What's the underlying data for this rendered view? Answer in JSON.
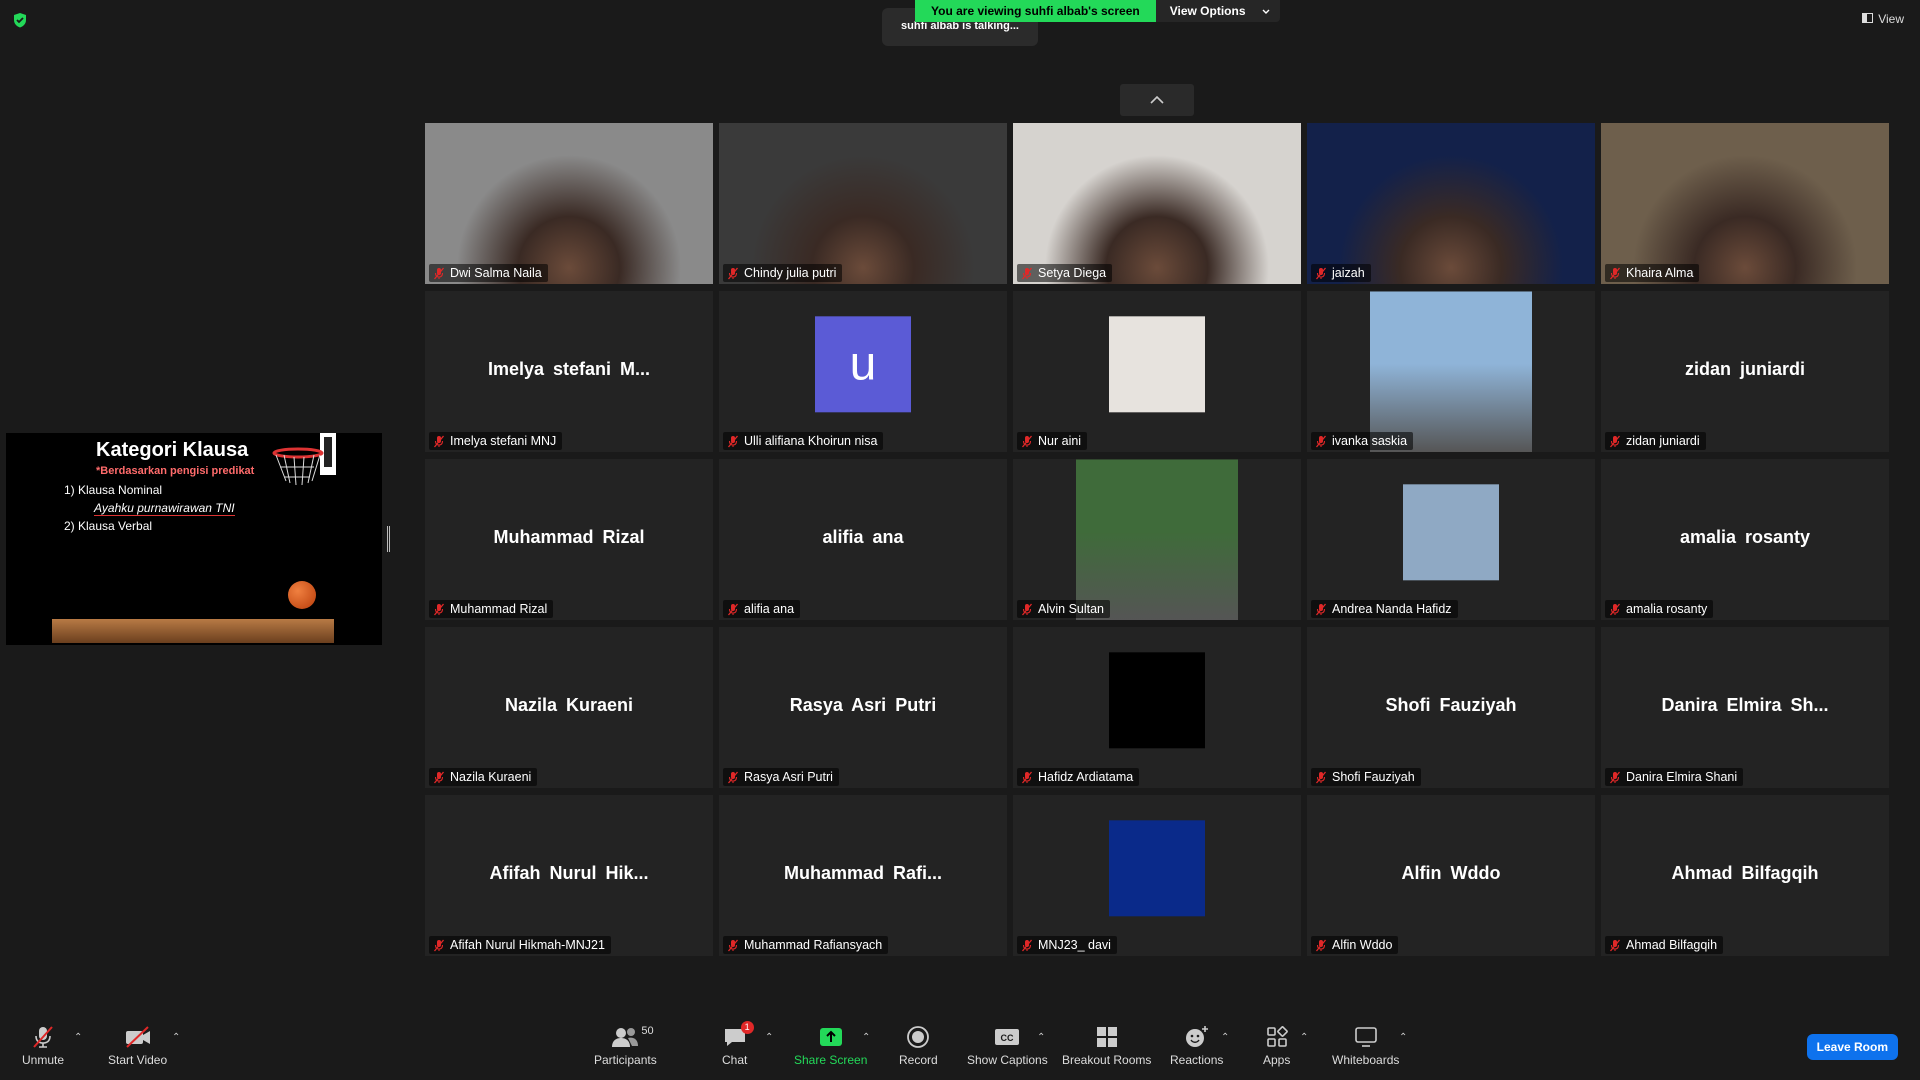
{
  "banner": {
    "viewing_text": "You are viewing suhfi albab's screen",
    "view_options": "View Options",
    "talking": "suhfi albab is talking..."
  },
  "top_right": {
    "view_label": "View"
  },
  "share": {
    "title": "Kategori Klausa",
    "subtitle": "*Berdasarkan pengisi predikat",
    "item1": "1)  Klausa Nominal",
    "example": "Ayahku purnawirawan TNI",
    "item2": "2)  Klausa Verbal"
  },
  "participants": [
    {
      "label": "Dwi Salma Naila",
      "type": "video",
      "bg": "#8a8a8a"
    },
    {
      "label": "Chindy julia putri",
      "type": "video",
      "bg": "#3a3a3a"
    },
    {
      "label": "Setya Diega",
      "type": "video",
      "bg": "#d6d3cf"
    },
    {
      "label": "jaizah",
      "type": "video",
      "bg": "#13214a"
    },
    {
      "label": "Khaira Alma",
      "type": "video",
      "bg": "#6e5f4c"
    },
    {
      "label": "Imelya stefani MNJ",
      "type": "name",
      "display": "Imelya stefani M..."
    },
    {
      "label": "Ulli alifiana Khoirun nisa",
      "type": "avatar",
      "letter": "u"
    },
    {
      "label": "Nur aini",
      "type": "photo",
      "bg": "#e7e3de"
    },
    {
      "label": "ivanka saskia",
      "type": "photo-tall",
      "bg": "#8fb4d8"
    },
    {
      "label": "zidan juniardi",
      "type": "name",
      "display": "zidan juniardi"
    },
    {
      "label": "Muhammad Rizal",
      "type": "name",
      "display": "Muhammad Rizal"
    },
    {
      "label": "alifia ana",
      "type": "name",
      "display": "alifia ana"
    },
    {
      "label": "Alvin Sultan",
      "type": "photo-tall",
      "bg": "#3f6b3a"
    },
    {
      "label": "Andrea Nanda Hafidz",
      "type": "photo",
      "bg": "#8fa9c4"
    },
    {
      "label": "amalia rosanty",
      "type": "name",
      "display": "amalia rosanty"
    },
    {
      "label": "Nazila Kuraeni",
      "type": "name",
      "display": "Nazila Kuraeni"
    },
    {
      "label": "Rasya Asri Putri",
      "type": "name",
      "display": "Rasya Asri Putri"
    },
    {
      "label": "Hafidz Ardiatama",
      "type": "photo",
      "bg": "#000000"
    },
    {
      "label": "Shofi Fauziyah",
      "type": "name",
      "display": "Shofi Fauziyah"
    },
    {
      "label": "Danira Elmira Shani",
      "type": "name",
      "display": "Danira Elmira Sh..."
    },
    {
      "label": "Afifah Nurul Hikmah-MNJ21",
      "type": "name",
      "display": "Afifah Nurul Hik..."
    },
    {
      "label": "Muhammad Rafiansyach",
      "type": "name",
      "display": "Muhammad Rafi..."
    },
    {
      "label": "MNJ23_ davi",
      "type": "photo",
      "bg": "#0a2a8a"
    },
    {
      "label": "Alfin Wddo",
      "type": "name",
      "display": "Alfin Wddo"
    },
    {
      "label": "Ahmad Bilfagqih",
      "type": "name",
      "display": "Ahmad Bilfagqih"
    }
  ],
  "toolbar": {
    "unmute": "Unmute",
    "start_video": "Start Video",
    "participants": "Participants",
    "participant_count": "50",
    "chat": "Chat",
    "chat_badge": "1",
    "share_screen": "Share Screen",
    "record": "Record",
    "show_captions": "Show Captions",
    "captions_icon_text": "CC",
    "breakout_rooms": "Breakout Rooms",
    "reactions": "Reactions",
    "apps": "Apps",
    "whiteboards": "Whiteboards",
    "leave": "Leave Room"
  },
  "colors": {
    "accent_green": "#23d959",
    "leave_blue": "#0e72ed",
    "mute_red": "#e02828"
  }
}
